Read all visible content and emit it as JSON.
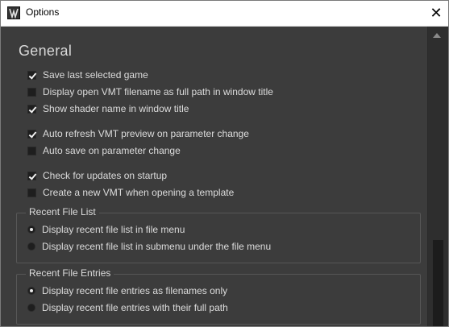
{
  "window": {
    "title": "Options",
    "close_glyph": "✕"
  },
  "general": {
    "heading": "General",
    "options": [
      {
        "label": "Save last selected game",
        "checked": true
      },
      {
        "label": "Display open VMT filename as full path in window title",
        "checked": false
      },
      {
        "label": "Show shader name in window title",
        "checked": true
      },
      {
        "label": "Auto refresh VMT preview on parameter change",
        "checked": true
      },
      {
        "label": "Auto save on parameter change",
        "checked": false
      },
      {
        "label": "Check for updates on startup",
        "checked": true
      },
      {
        "label": "Create a new VMT when opening a template",
        "checked": false
      }
    ]
  },
  "recent_file_list": {
    "title": "Recent File List",
    "options": [
      {
        "label": "Display recent file list in file menu",
        "selected": true
      },
      {
        "label": "Display recent file list in submenu under the file menu",
        "selected": false
      }
    ]
  },
  "recent_file_entries": {
    "title": "Recent File Entries",
    "options": [
      {
        "label": "Display recent file entries as filenames only",
        "selected": true
      },
      {
        "label": "Display recent file entries with their full path",
        "selected": false
      }
    ]
  },
  "icons": {
    "app": "app-logo-icon",
    "close": "close-icon",
    "scroll_up": "scroll-up-arrow-icon"
  }
}
